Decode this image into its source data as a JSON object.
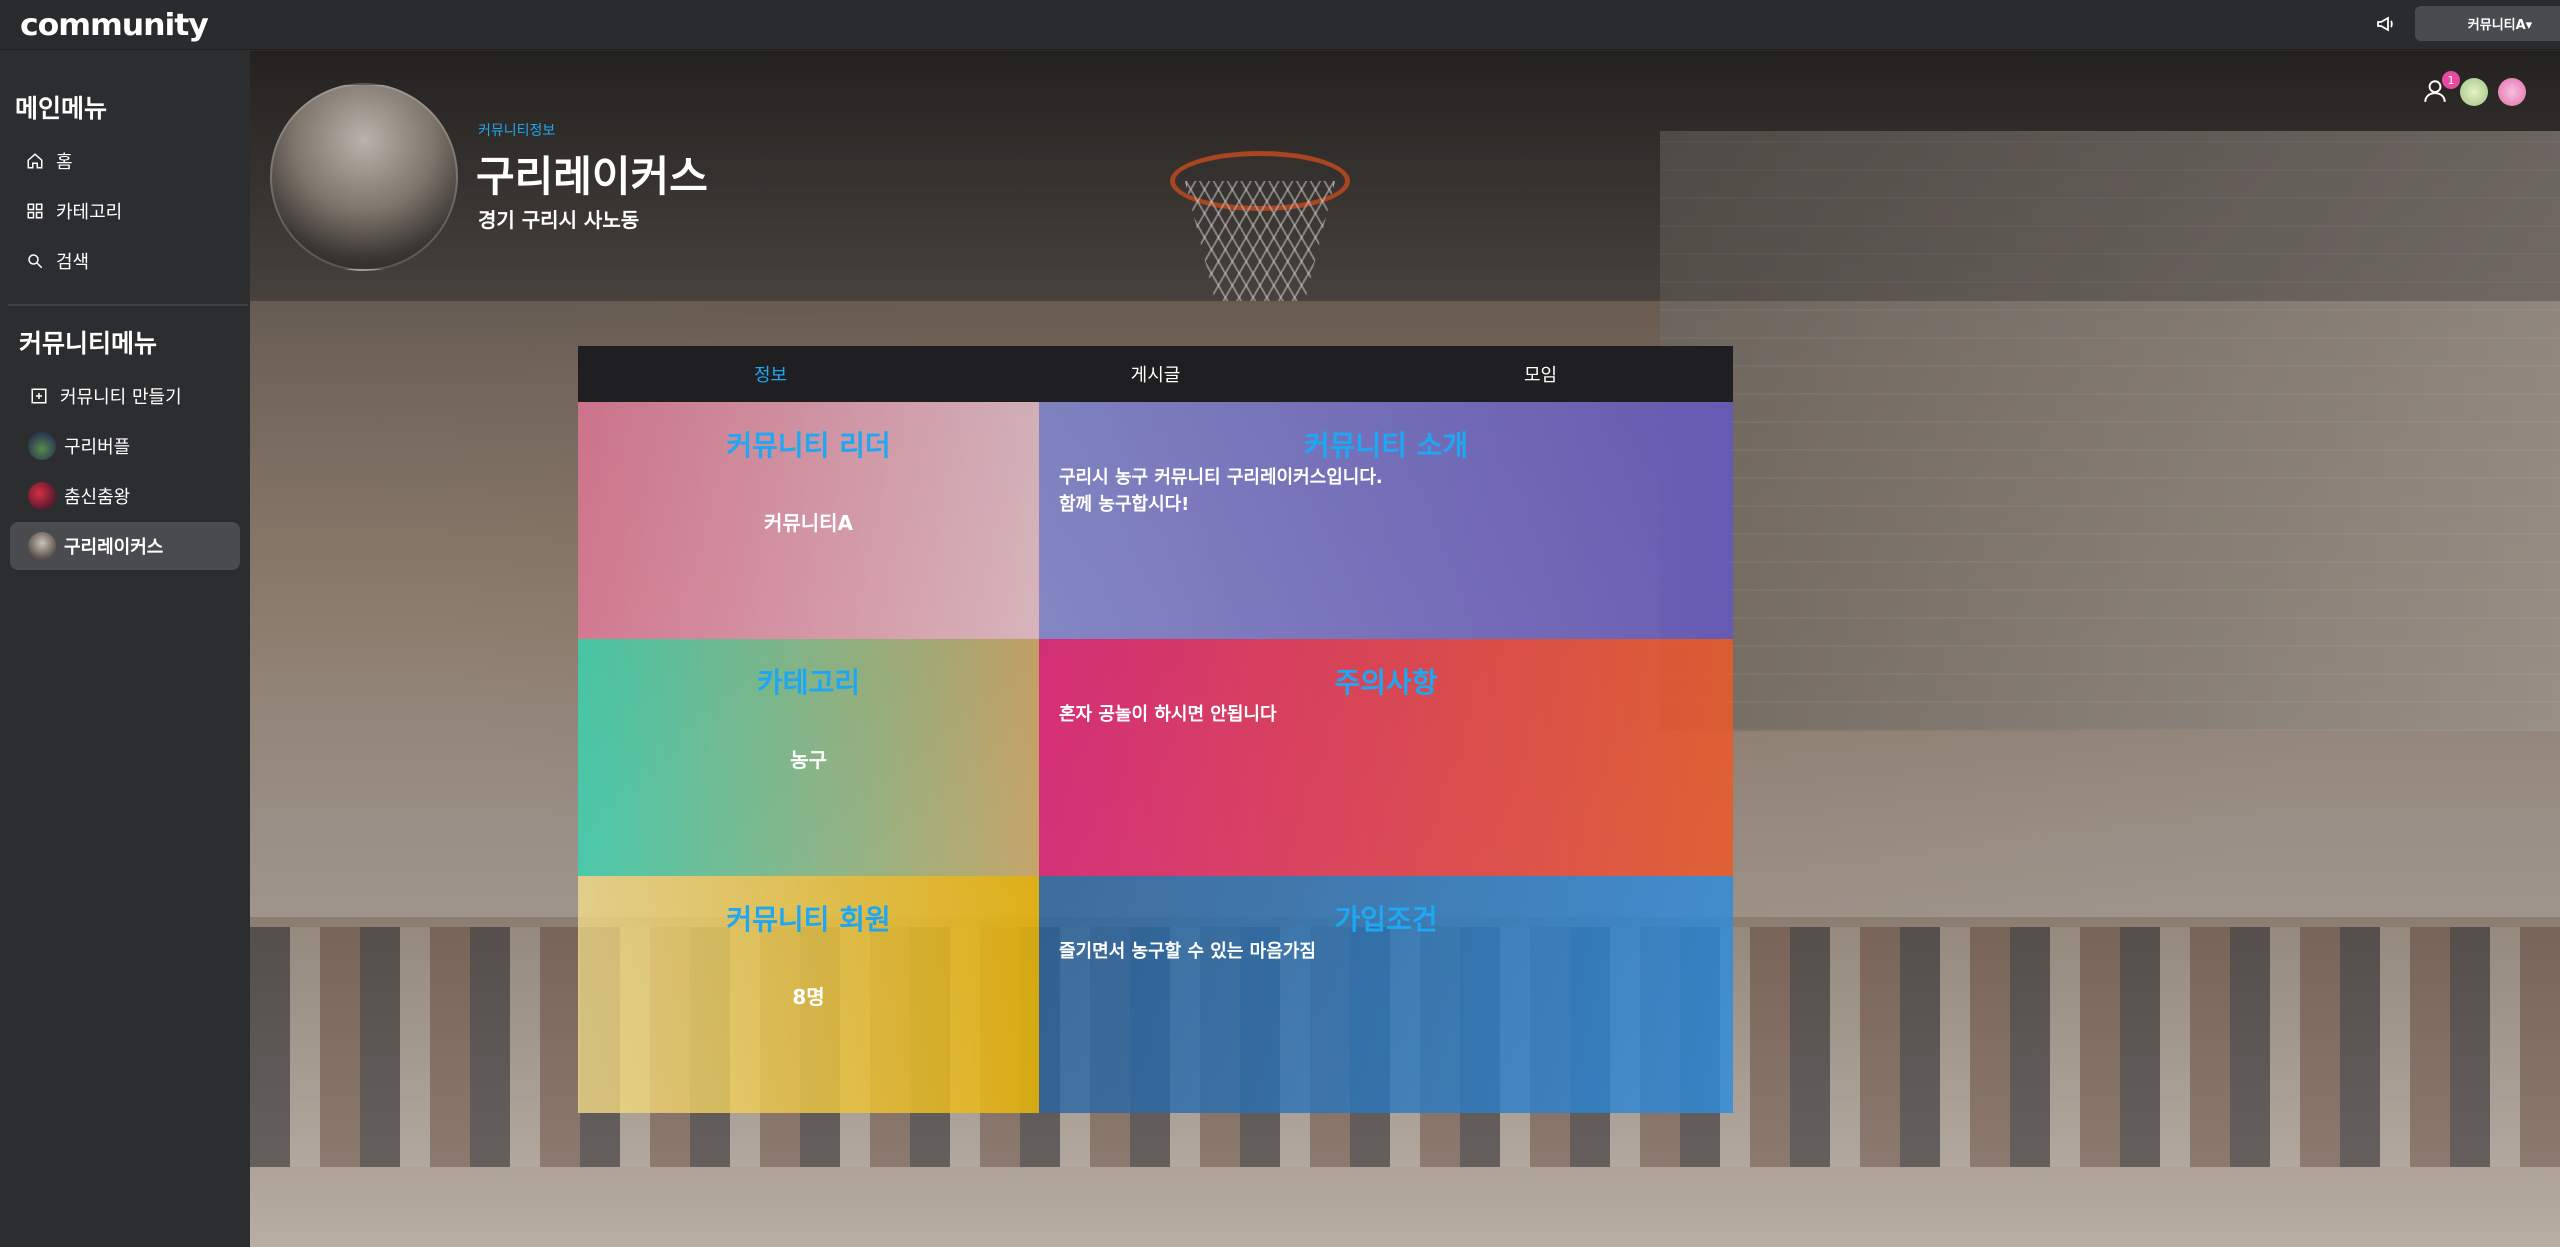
{
  "app": {
    "logo": "community"
  },
  "topbar": {
    "user_menu_label": "커뮤니티A▾"
  },
  "sidebar": {
    "main_heading": "메인메뉴",
    "main_items": [
      {
        "label": "홈",
        "icon": "home-icon"
      },
      {
        "label": "카테고리",
        "icon": "grid-icon"
      },
      {
        "label": "검색",
        "icon": "search-icon"
      }
    ],
    "community_heading": "커뮤니티메뉴",
    "community_items": [
      {
        "label": "커뮤니티 만들기",
        "icon": "plus-square-icon"
      },
      {
        "label": "구리버플",
        "icon": "avatar"
      },
      {
        "label": "춤신춤왕",
        "icon": "avatar"
      },
      {
        "label": "구리레이커스",
        "icon": "avatar",
        "active": true
      }
    ]
  },
  "header": {
    "info_label": "커뮤니티정보",
    "title": "구리레이커스",
    "location": "경기 구리시 사노동",
    "notification_count": "1"
  },
  "tabs": [
    {
      "label": "정보",
      "active": true
    },
    {
      "label": "게시글"
    },
    {
      "label": "모임"
    }
  ],
  "cards": {
    "leader": {
      "title": "커뮤니티 리더",
      "value": "커뮤니티A"
    },
    "intro": {
      "title": "커뮤니티 소개",
      "text": "구리시 농구 커뮤니티 구리레이커스입니다.\n함께 농구합시다!"
    },
    "category": {
      "title": "카테고리",
      "value": "농구"
    },
    "caution": {
      "title": "주의사항",
      "text": "혼자 공놀이 하시면 안됩니다"
    },
    "members": {
      "title": "커뮤니티 회원",
      "value": "8명"
    },
    "join": {
      "title": "가입조건",
      "text": "즐기면서 농구할 수 있는 마음가짐"
    }
  },
  "colors": {
    "accent": "#1ea7f3",
    "badge": "#e84a9d",
    "sidebar_bg": "#2c2d2f"
  }
}
